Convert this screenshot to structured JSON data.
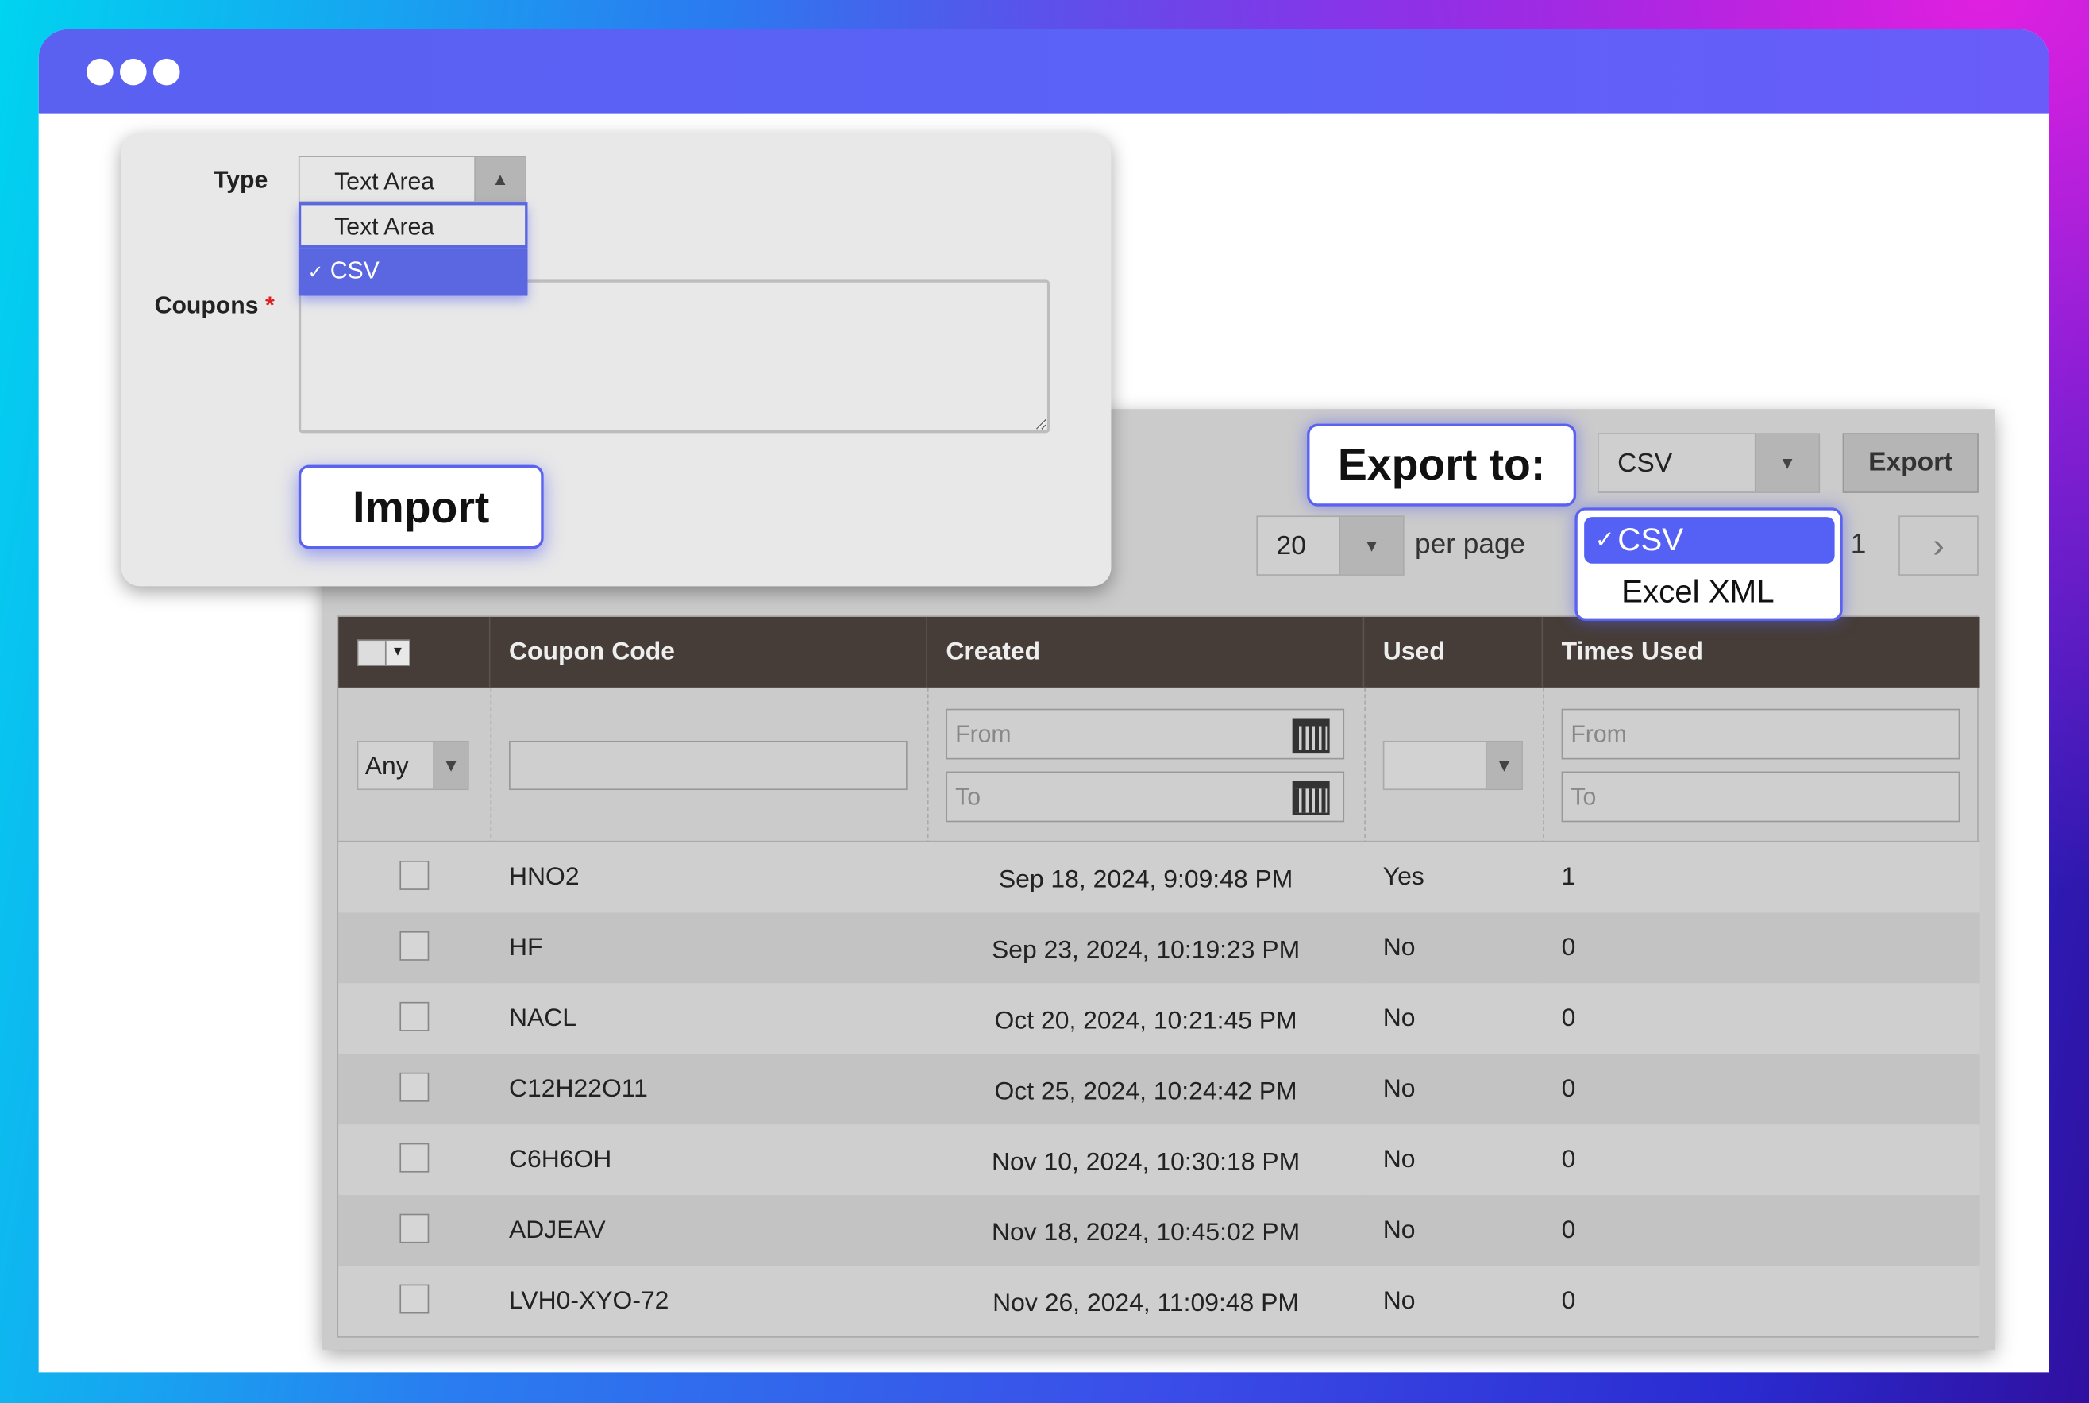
{
  "colors": {
    "accent": "#5560f5",
    "header_bg": "#463d38",
    "required": "#e02020"
  },
  "import_form": {
    "type_label": "Type",
    "type_value": "Text Area",
    "type_options": [
      {
        "label": "Text Area",
        "selected": false
      },
      {
        "label": "CSV",
        "selected": true
      }
    ],
    "coupons_label": "Coupons",
    "required_mark": "*",
    "coupons_value": "",
    "import_button": "Import"
  },
  "toolbar": {
    "export_to_label": "Export to:",
    "export_format": "CSV",
    "export_button": "Export",
    "export_options": [
      {
        "label": "CSV",
        "selected": true
      },
      {
        "label": "Excel XML",
        "selected": false
      }
    ],
    "per_page_value": "20",
    "per_page_label": "per page",
    "page_number": "1",
    "next_icon": "chevron-right-icon"
  },
  "grid": {
    "columns": [
      "Coupon Code",
      "Created",
      "Used",
      "Times Used"
    ],
    "filters": {
      "mass_select": "Any",
      "coupon_code": "",
      "created_from_placeholder": "From",
      "created_to_placeholder": "To",
      "used": "",
      "times_from_placeholder": "From",
      "times_to_placeholder": "To"
    },
    "rows": [
      {
        "code": "HNO2",
        "created": "Sep 18, 2024, 9:09:48 PM",
        "used": "Yes",
        "times_used": "1"
      },
      {
        "code": "HF",
        "created": "Sep 23, 2024, 10:19:23 PM",
        "used": "No",
        "times_used": "0"
      },
      {
        "code": "NACL",
        "created": "Oct 20, 2024, 10:21:45 PM",
        "used": "No",
        "times_used": "0"
      },
      {
        "code": "C12H22O11",
        "created": "Oct 25, 2024, 10:24:42 PM",
        "used": "No",
        "times_used": "0"
      },
      {
        "code": "C6H6OH",
        "created": "Nov 10, 2024, 10:30:18 PM",
        "used": "No",
        "times_used": "0"
      },
      {
        "code": "ADJEAV",
        "created": "Nov 18, 2024, 10:45:02 PM",
        "used": "No",
        "times_used": "0"
      },
      {
        "code": "LVH0-XYO-72",
        "created": "Nov 26, 2024, 11:09:48 PM",
        "used": "No",
        "times_used": "0"
      }
    ]
  }
}
